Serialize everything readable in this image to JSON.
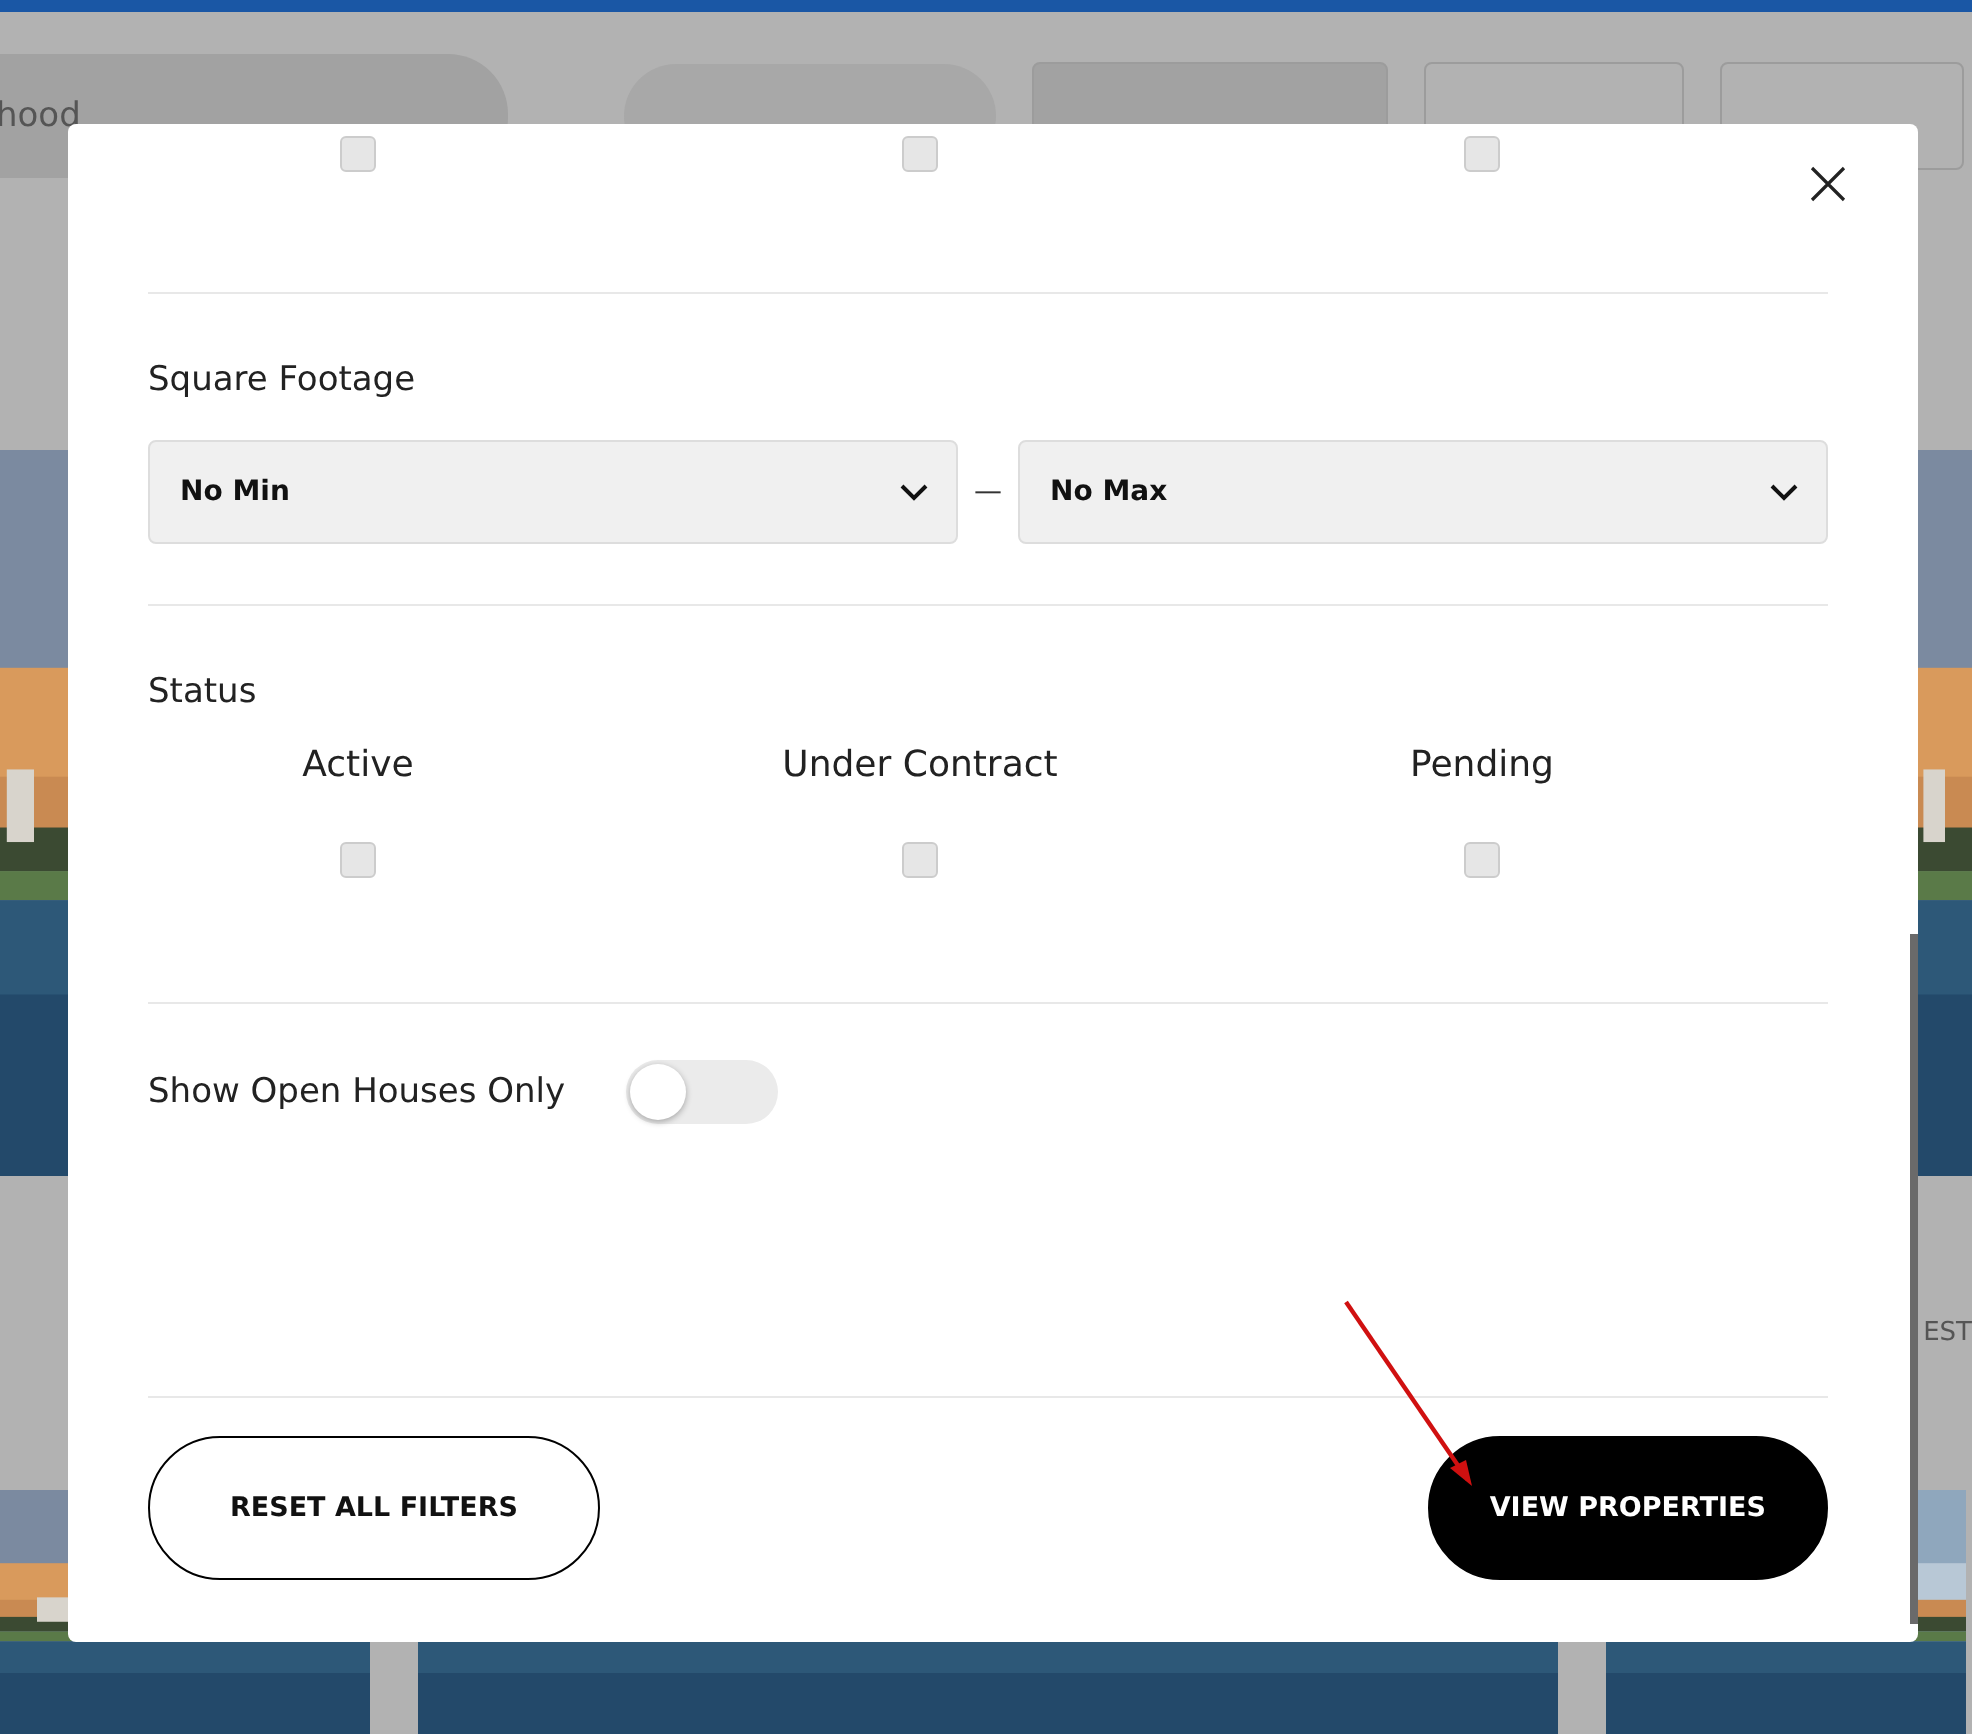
{
  "background": {
    "search_field": {
      "placeholder": "hood"
    },
    "listing_text": "EST"
  },
  "modal": {
    "previous_checkboxes": [
      {
        "checked": false
      },
      {
        "checked": false
      },
      {
        "checked": false
      }
    ],
    "square_footage": {
      "label": "Square Footage",
      "min": "No Min",
      "separator": "—",
      "max": "No Max"
    },
    "status": {
      "label": "Status",
      "options": [
        {
          "label": "Active",
          "checked": false
        },
        {
          "label": "Under Contract",
          "checked": false
        },
        {
          "label": "Pending",
          "checked": false
        }
      ]
    },
    "open_houses": {
      "label": "Show Open Houses Only",
      "on": false
    },
    "buttons": [
      {
        "label": "RESET ALL FILTERS",
        "kind": "outline"
      },
      {
        "label": "VIEW PROPERTIES",
        "kind": "primary"
      }
    ]
  }
}
